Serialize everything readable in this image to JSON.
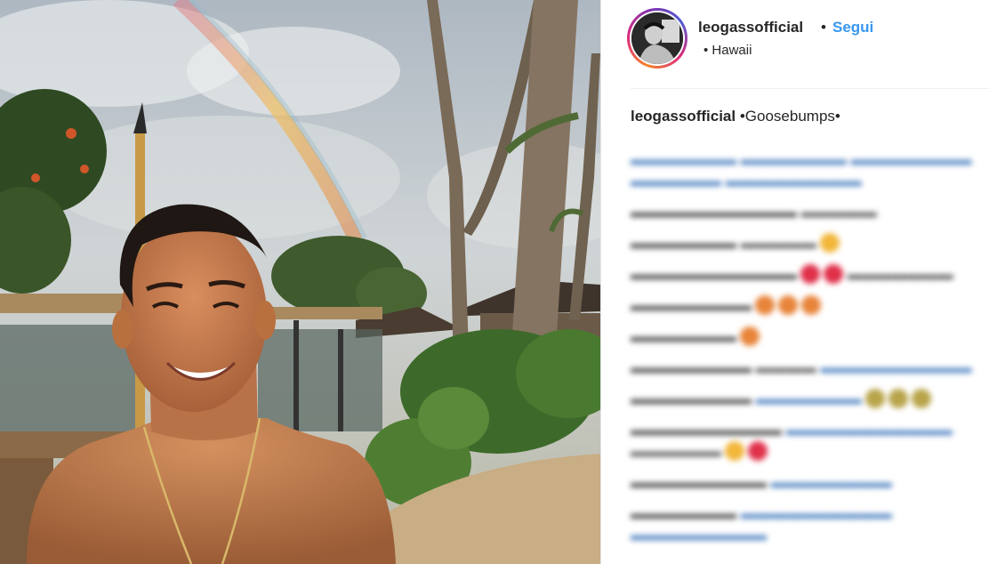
{
  "post": {
    "username": "leogassofficial",
    "separator": "•",
    "follow_label": "Segui",
    "location": "• Hawaii",
    "caption_user": "leogassofficial",
    "caption_text": " •Goosebumps•"
  },
  "colors": {
    "follow": "#3897f0",
    "text": "#262626",
    "avatar_ring": [
      "#f58529",
      "#dd2a7b",
      "#8134af"
    ]
  },
  "photo": {
    "description_icon": "photo-image"
  }
}
